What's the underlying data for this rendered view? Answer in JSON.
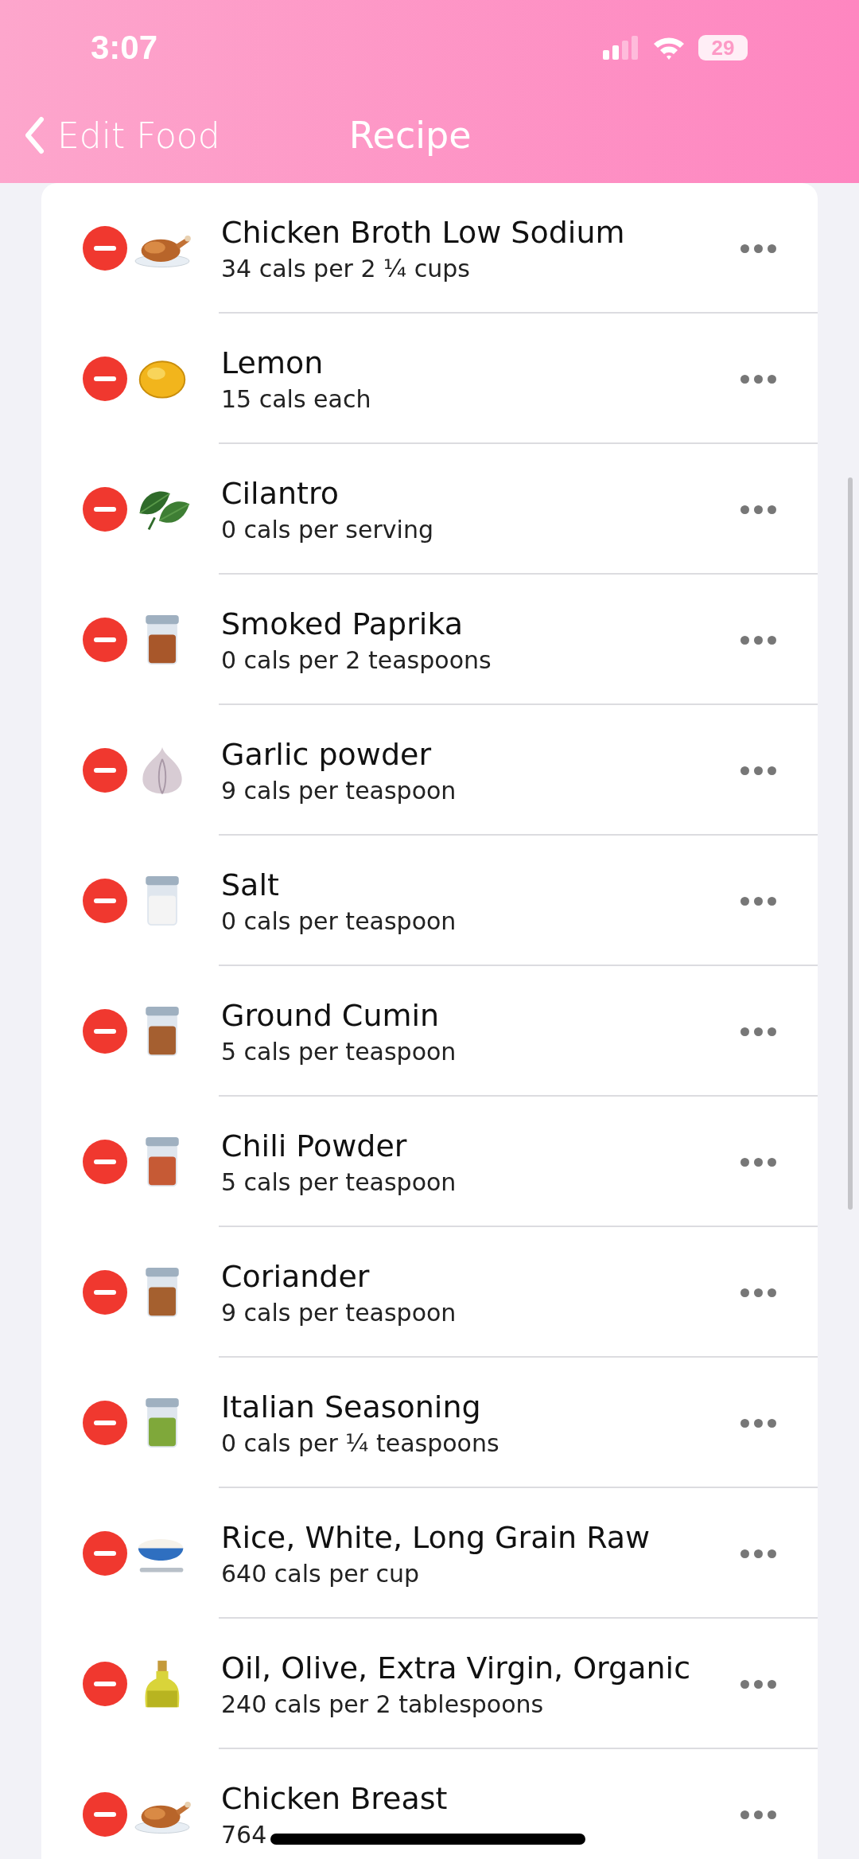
{
  "status_bar": {
    "time": "3:07",
    "battery": "29"
  },
  "nav": {
    "back": "Edit Food",
    "title": "Recipe"
  },
  "ingredients": [
    {
      "name": "Chicken Broth Low Sodium",
      "detail": "34 cals per 2 ¼ cups",
      "kind": "chicken"
    },
    {
      "name": "Lemon",
      "detail": "15 cals each",
      "kind": "lemon"
    },
    {
      "name": "Cilantro",
      "detail": "0 cals per serving",
      "kind": "leaves"
    },
    {
      "name": "Smoked Paprika",
      "detail": "0 cals per 2 teaspoons",
      "kind": "jar",
      "color": "#a8572a"
    },
    {
      "name": "Garlic powder",
      "detail": "9 cals per teaspoon",
      "kind": "garlic"
    },
    {
      "name": "Salt",
      "detail": "0 cals per teaspoon",
      "kind": "jar",
      "color": "#f4f4f4"
    },
    {
      "name": "Ground Cumin",
      "detail": "5 cals per teaspoon",
      "kind": "jar",
      "color": "#a55f30"
    },
    {
      "name": "Chili Powder",
      "detail": "5 cals per teaspoon",
      "kind": "jar",
      "color": "#c65a35"
    },
    {
      "name": "Coriander",
      "detail": "9 cals per teaspoon",
      "kind": "jar",
      "color": "#a5602f"
    },
    {
      "name": "Italian Seasoning",
      "detail": "0 cals per ¼ teaspoons",
      "kind": "jar",
      "color": "#7fa83a"
    },
    {
      "name": "Rice, White, Long Grain Raw",
      "detail": "640 cals per cup",
      "kind": "rice"
    },
    {
      "name": "Oil, Olive, Extra Virgin, Organic",
      "detail": "240 cals per 2 tablespoons",
      "kind": "oil"
    },
    {
      "name": "Chicken Breast",
      "detail": "764",
      "kind": "chicken"
    }
  ]
}
